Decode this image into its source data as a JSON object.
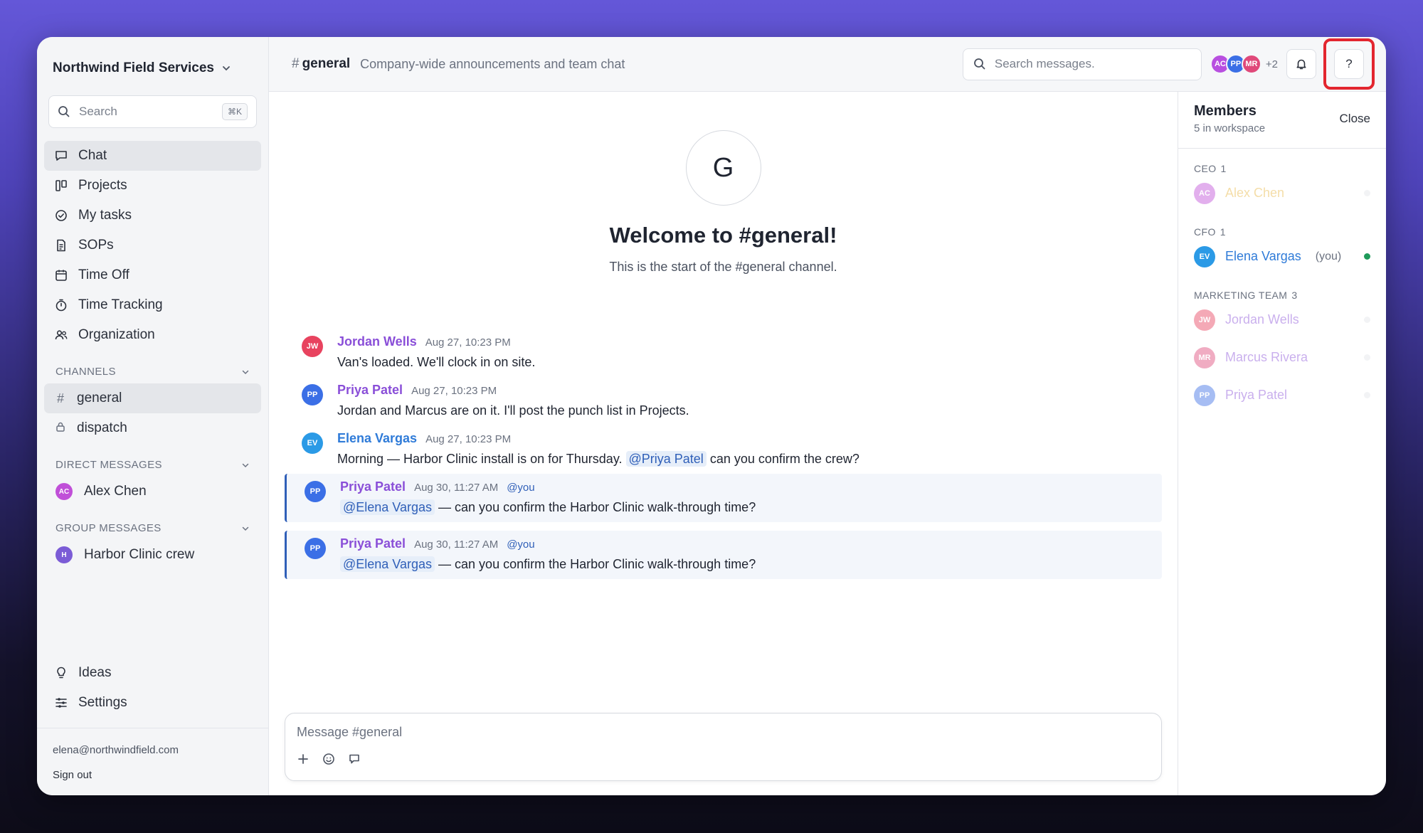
{
  "workspace": {
    "name": "Northwind Field Services"
  },
  "sidebar": {
    "search_placeholder": "Search",
    "search_shortcut": "⌘K",
    "nav": [
      {
        "label": "Chat",
        "icon": "chat-bubble-icon",
        "active": true
      },
      {
        "label": "Projects",
        "icon": "kanban-icon"
      },
      {
        "label": "My tasks",
        "icon": "check-circle-icon"
      },
      {
        "label": "SOPs",
        "icon": "document-icon"
      },
      {
        "label": "Time Off",
        "icon": "calendar-icon"
      },
      {
        "label": "Time Tracking",
        "icon": "stopwatch-icon"
      },
      {
        "label": "Organization",
        "icon": "people-icon"
      }
    ],
    "channels_header": "CHANNELS",
    "channels": [
      {
        "label": "general",
        "prefix": "#",
        "active": true
      },
      {
        "label": "dispatch",
        "prefix": "lock"
      }
    ],
    "dm_header": "DIRECT MESSAGES",
    "dms": [
      {
        "label": "Alex Chen",
        "initials": "AC",
        "color": "#c04fd8"
      }
    ],
    "group_header": "GROUP MESSAGES",
    "groups": [
      {
        "label": "Harbor Clinic crew",
        "initials": "H",
        "color": "#7b5cd6"
      }
    ],
    "bottom": [
      {
        "label": "Ideas",
        "icon": "lightbulb-icon"
      },
      {
        "label": "Settings",
        "icon": "sliders-icon"
      }
    ],
    "user_email": "elena@northwindfield.com",
    "sign_out": "Sign out"
  },
  "topbar": {
    "hash": "#",
    "channel": "general",
    "description": "Company-wide announcements and team chat",
    "search_placeholder": "Search messages.",
    "avatars": [
      {
        "initials": "AC",
        "color": "#b84fe0"
      },
      {
        "initials": "PP",
        "color": "#3b6fe6"
      },
      {
        "initials": "MR",
        "color": "#e0497a"
      }
    ],
    "more_count": "+2",
    "help": "?"
  },
  "welcome": {
    "avatar_letter": "G",
    "title": "Welcome to #general!",
    "subtitle": "This is the start of the #general channel."
  },
  "messages": [
    {
      "initials": "JW",
      "color": "#e8435f",
      "author": "Jordan Wells",
      "author_color": "#8a4fd8",
      "time": "Aug 27, 10:23 PM",
      "text": "Van's loaded. We'll clock in on site."
    },
    {
      "initials": "PP",
      "color": "#3b6fe6",
      "author": "Priya Patel",
      "author_color": "#8a4fd8",
      "time": "Aug 27, 10:23 PM",
      "text": "Jordan and Marcus are on it. I'll post the punch list in Projects."
    },
    {
      "initials": "EV",
      "color": "#2b9ae6",
      "author": "Elena Vargas",
      "author_color": "#2f7bd8",
      "time": "Aug 27, 10:23 PM",
      "text_before": "Morning — Harbor Clinic install is on for Thursday.",
      "mention": "@Priya Patel",
      "text_after": "can you confirm the crew?"
    },
    {
      "initials": "PP",
      "color": "#3b6fe6",
      "author": "Priya Patel",
      "author_color": "#8a4fd8",
      "time": "Aug 30, 11:27 AM",
      "you_tag": "@you",
      "mention": "@Elena Vargas",
      "text_after": "— can you confirm the Harbor Clinic walk-through time?"
    },
    {
      "initials": "PP",
      "color": "#3b6fe6",
      "author": "Priya Patel",
      "author_color": "#8a4fd8",
      "time": "Aug 30, 11:27 AM",
      "you_tag": "@you",
      "mention": "@Elena Vargas",
      "text_after": "— can you confirm the Harbor Clinic walk-through time?"
    }
  ],
  "composer": {
    "placeholder": "Message #general"
  },
  "members_panel": {
    "title": "Members",
    "subtitle": "5 in workspace",
    "close": "Close",
    "groups": [
      {
        "name": "CEO",
        "count": "1",
        "members": [
          {
            "initials": "AC",
            "name": "Alex Chen",
            "color": "#c04fd8",
            "name_color": "#e8b640",
            "online": false
          }
        ]
      },
      {
        "name": "CFO",
        "count": "1",
        "members": [
          {
            "initials": "EV",
            "name": "Elena Vargas",
            "you": "(you)",
            "color": "#2b9ae6",
            "name_color": "#2f7bd8",
            "online": true
          }
        ]
      },
      {
        "name": "MARKETING TEAM",
        "count": "3",
        "members": [
          {
            "initials": "JW",
            "name": "Jordan Wells",
            "color": "#e8435f",
            "name_color": "#8a4fd8",
            "online": false
          },
          {
            "initials": "MR",
            "name": "Marcus Rivera",
            "color": "#e0497a",
            "name_color": "#8a4fd8",
            "online": false
          },
          {
            "initials": "PP",
            "name": "Priya Patel",
            "color": "#3b6fe6",
            "name_color": "#8a4fd8",
            "online": false
          }
        ]
      }
    ],
    "online_color": "#1f9a5a"
  }
}
